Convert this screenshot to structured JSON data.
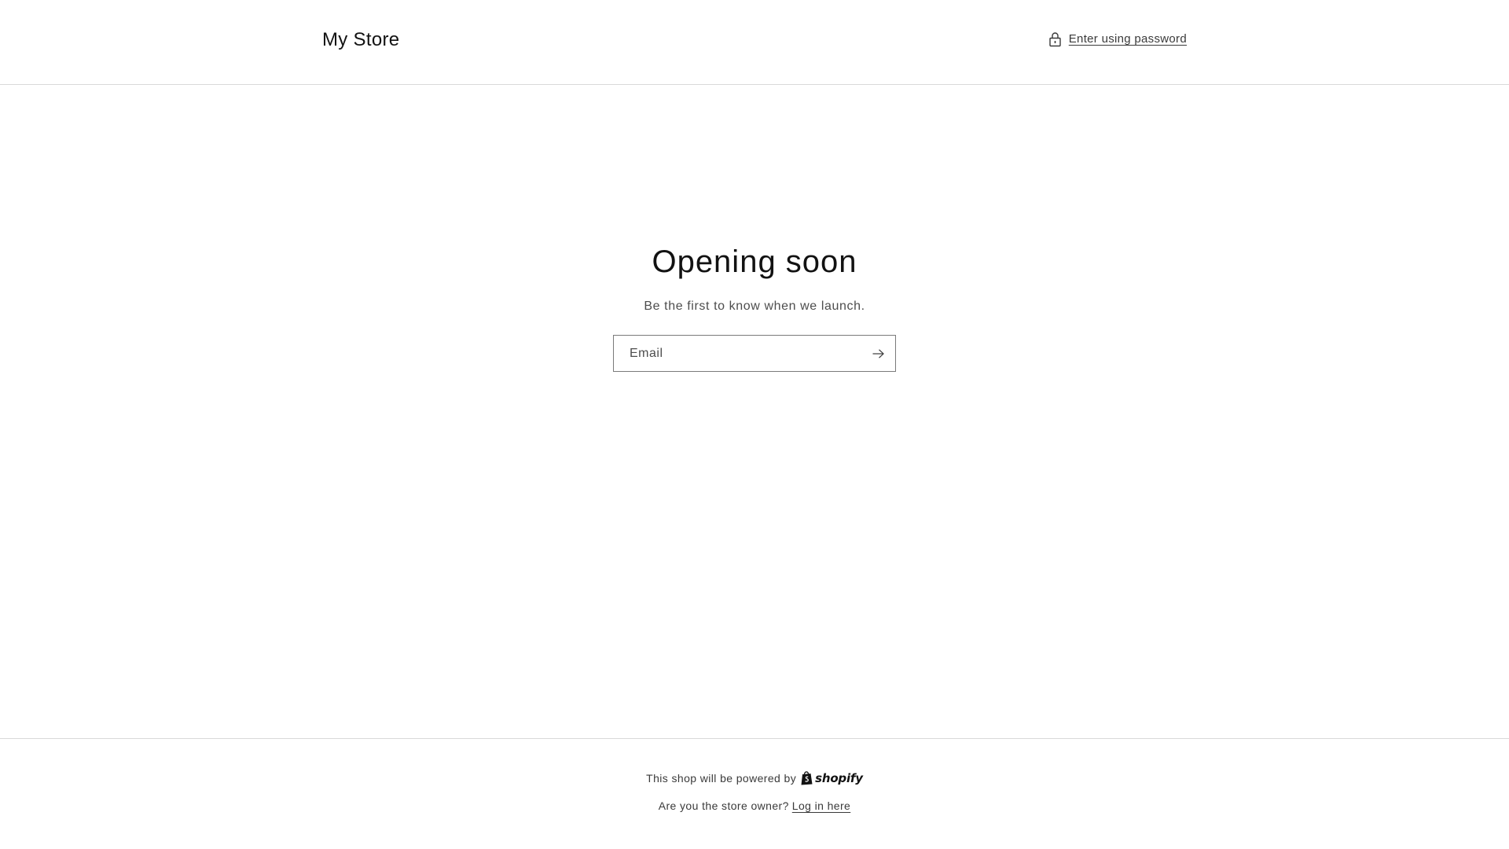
{
  "header": {
    "store_title": "My Store",
    "password_link_label": "Enter using password",
    "lock_icon": "lock-icon"
  },
  "main": {
    "heading": "Opening soon",
    "subtext": "Be the first to know when we launch.",
    "email": {
      "placeholder": "Email",
      "value": "",
      "submit_icon": "arrow-right-icon"
    }
  },
  "footer": {
    "powered_by_text": "This shop will be powered by",
    "shopify_wordmark": "shopify",
    "shopify_icon": "shopify-bag-icon",
    "owner_question": "Are you the store owner?",
    "login_link_label": "Log in here"
  },
  "colors": {
    "text_primary": "#121212",
    "text_secondary": "#4d4d4d",
    "border": "#d9d9d9",
    "input_border": "#7a7a7a",
    "background": "#ffffff"
  }
}
